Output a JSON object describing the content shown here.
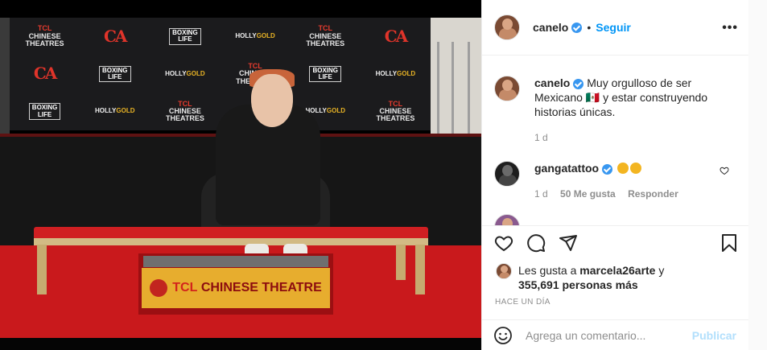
{
  "photo": {
    "logos": {
      "tcl": [
        "TCL",
        "CHINESE",
        "THEATRES"
      ],
      "ca": "CA",
      "boxing": [
        "BOXING",
        "LIFE"
      ],
      "holly": [
        "HOLLY",
        "GOLD"
      ]
    },
    "plaque": {
      "brand": "TCL",
      "name": "CHINESE THEATRE"
    }
  },
  "header": {
    "username": "canelo",
    "separator": "•",
    "follow_label": "Seguir",
    "more_label": "•••"
  },
  "caption": {
    "username": "canelo",
    "text": "Muy orgulloso de ser Mexicano 🇲🇽 y estar construyendo historias únicas.",
    "time": "1 d"
  },
  "comments": [
    {
      "username": "gangatattoo",
      "time": "1 d",
      "likes": "50 Me gusta",
      "reply_label": "Responder"
    }
  ],
  "partial_comment": {
    "username": "... ",
    "text": ""
  },
  "likes": {
    "prefix": "Les gusta a",
    "user": "marcela26arte",
    "joiner": "y",
    "count": "355,691 personas más"
  },
  "post_time": "HACE UN DÍA",
  "composer": {
    "placeholder": "Agrega un comentario...",
    "post_label": "Publicar"
  },
  "colors": {
    "link": "#0095f6",
    "verified": "#3897f0",
    "muted": "#8e8e8e",
    "post_disabled": "#b2dffc"
  }
}
